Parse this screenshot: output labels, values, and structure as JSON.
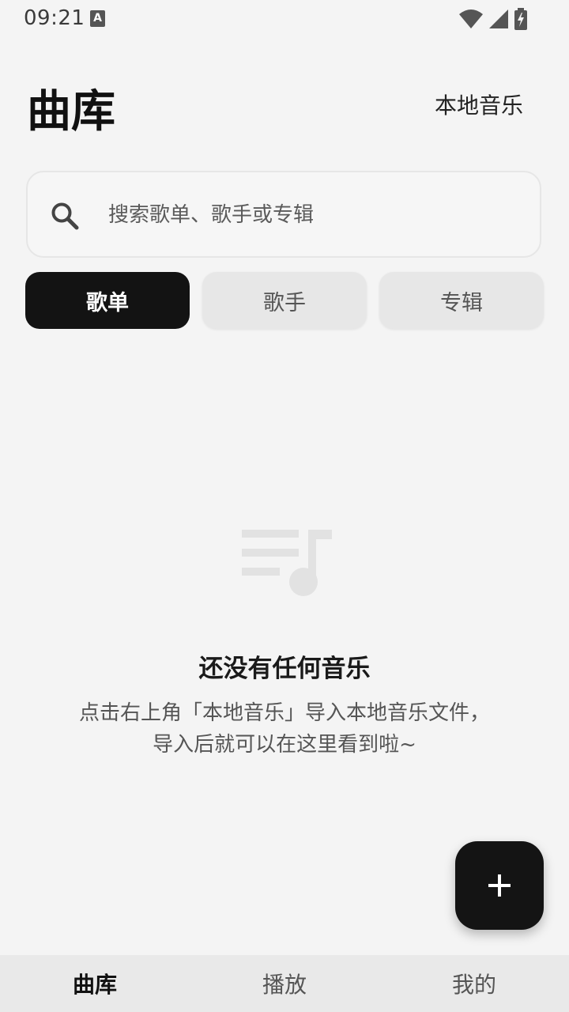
{
  "status_bar": {
    "time": "09:21",
    "keyboard_badge": "A",
    "icons": [
      "wifi-icon",
      "signal-icon",
      "battery-charging-icon"
    ]
  },
  "header": {
    "title": "曲库",
    "local_music_label": "本地音乐"
  },
  "search": {
    "placeholder": "搜索歌单、歌手或专辑",
    "icon": "search-icon"
  },
  "tabs": [
    {
      "label": "歌单",
      "active": true
    },
    {
      "label": "歌手",
      "active": false
    },
    {
      "label": "专辑",
      "active": false
    }
  ],
  "empty_state": {
    "icon": "playlist-music-icon",
    "title": "还没有任何音乐",
    "description_line1": "点击右上角「本地音乐」导入本地音乐文件，",
    "description_line2": "导入后就可以在这里看到啦~"
  },
  "fab": {
    "icon": "plus-icon"
  },
  "bottom_nav": [
    {
      "label": "曲库",
      "active": true
    },
    {
      "label": "播放",
      "active": false
    },
    {
      "label": "我的",
      "active": false
    }
  ],
  "colors": {
    "background": "#f4f4f4",
    "accent_dark": "#131313",
    "tab_inactive": "#e7e7e7",
    "nav_background": "#e9e9e9"
  }
}
